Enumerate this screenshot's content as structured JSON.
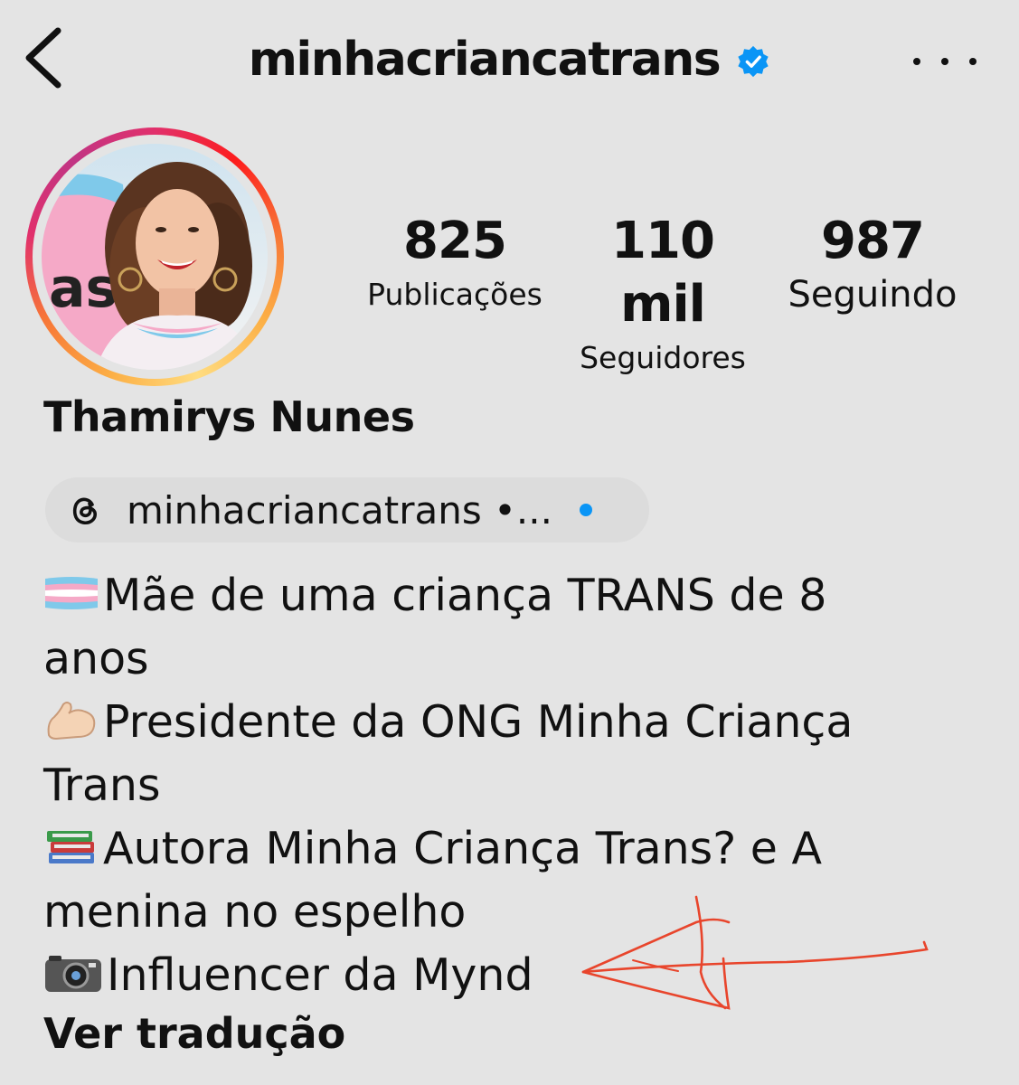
{
  "header": {
    "username": "minhacriancatrans",
    "verified": true
  },
  "profile": {
    "name": "Thamirys Nunes",
    "avatar_colors": {
      "ring_start": "#fcaf45",
      "ring_mid": "#e1306c",
      "ring_end": "#c13584"
    }
  },
  "stats": [
    {
      "value": "825",
      "label": "Publicações"
    },
    {
      "value": "110 mil",
      "label": "Seguidores"
    },
    {
      "value": "987",
      "label": "Seguindo"
    }
  ],
  "threads": {
    "text": "minhacriancatrans •...",
    "dot_color": "#0a95f6"
  },
  "bio": {
    "line1": "Mãe de uma criança TRANS de 8",
    "line1b": "anos",
    "line2": "Presidente da ONG Minha Criança",
    "line2b": "Trans",
    "line3": "Autora Minha Criança Trans? e A",
    "line3b": "menina no espelho",
    "line4": "Influencer da Mynd",
    "emojis": [
      "transgender-flag-icon",
      "flexed-biceps-icon",
      "books-icon",
      "camera-icon"
    ]
  },
  "see_translation": "Ver tradução",
  "annotation": {
    "color": "#e8452c",
    "shape": "hand-drawn arrow pointing left"
  }
}
